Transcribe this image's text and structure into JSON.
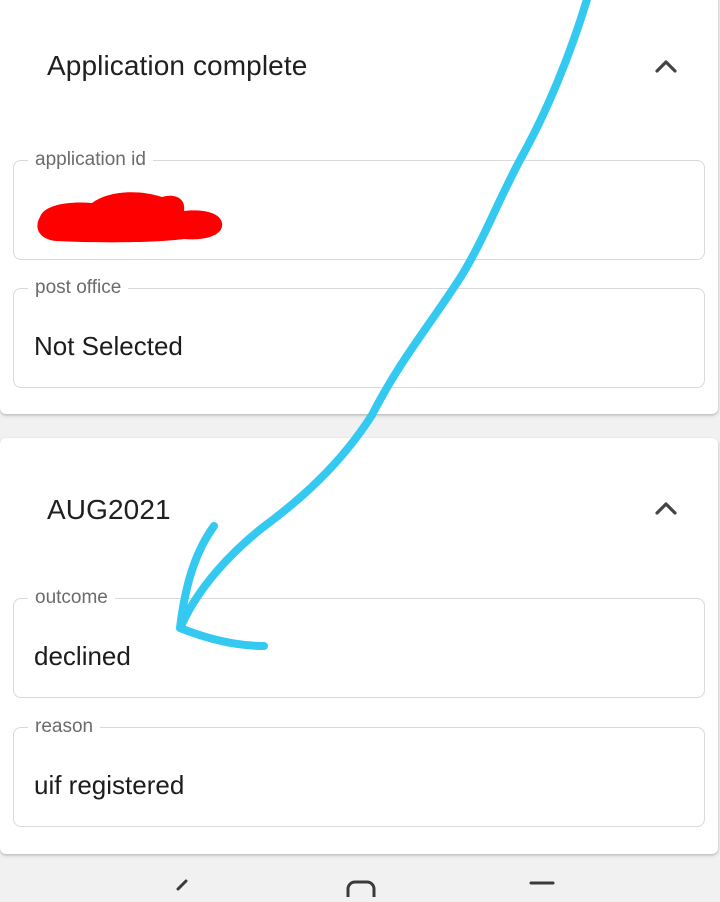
{
  "sections": [
    {
      "title": "Application complete",
      "expanded": true,
      "fields": [
        {
          "label": "application id",
          "value": "",
          "redacted": true
        },
        {
          "label": "post office",
          "value": "Not Selected"
        }
      ]
    },
    {
      "title": "AUG2021",
      "expanded": true,
      "fields": [
        {
          "label": "outcome",
          "value": "declined"
        },
        {
          "label": "reason",
          "value": "uif registered"
        }
      ]
    }
  ],
  "icons": {
    "collapse": "chevron-up-icon",
    "nav_back": "back-icon",
    "nav_home": "home-icon",
    "nav_recents": "recents-icon"
  },
  "colors": {
    "redaction": "#ff0000",
    "annotation_arrow": "#33c9f0"
  }
}
